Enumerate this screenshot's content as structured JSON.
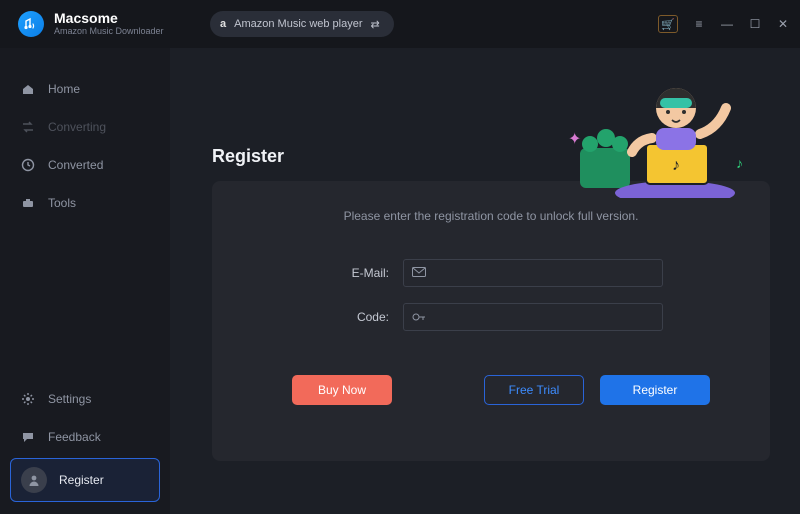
{
  "brand": {
    "title": "Macsome",
    "subtitle": "Amazon Music Downloader"
  },
  "source_pill": {
    "label": "Amazon Music web player"
  },
  "sidebar": {
    "items": [
      {
        "label": "Home"
      },
      {
        "label": "Converting"
      },
      {
        "label": "Converted"
      },
      {
        "label": "Tools"
      }
    ],
    "settings_label": "Settings",
    "feedback_label": "Feedback",
    "register_label": "Register"
  },
  "page": {
    "title": "Register"
  },
  "panel": {
    "instructions": "Please enter the registration code to unlock full version.",
    "email_label": "E-Mail:",
    "code_label": "Code:",
    "email_value": "",
    "code_value": "",
    "buy_label": "Buy Now",
    "trial_label": "Free Trial",
    "register_label": "Register"
  }
}
